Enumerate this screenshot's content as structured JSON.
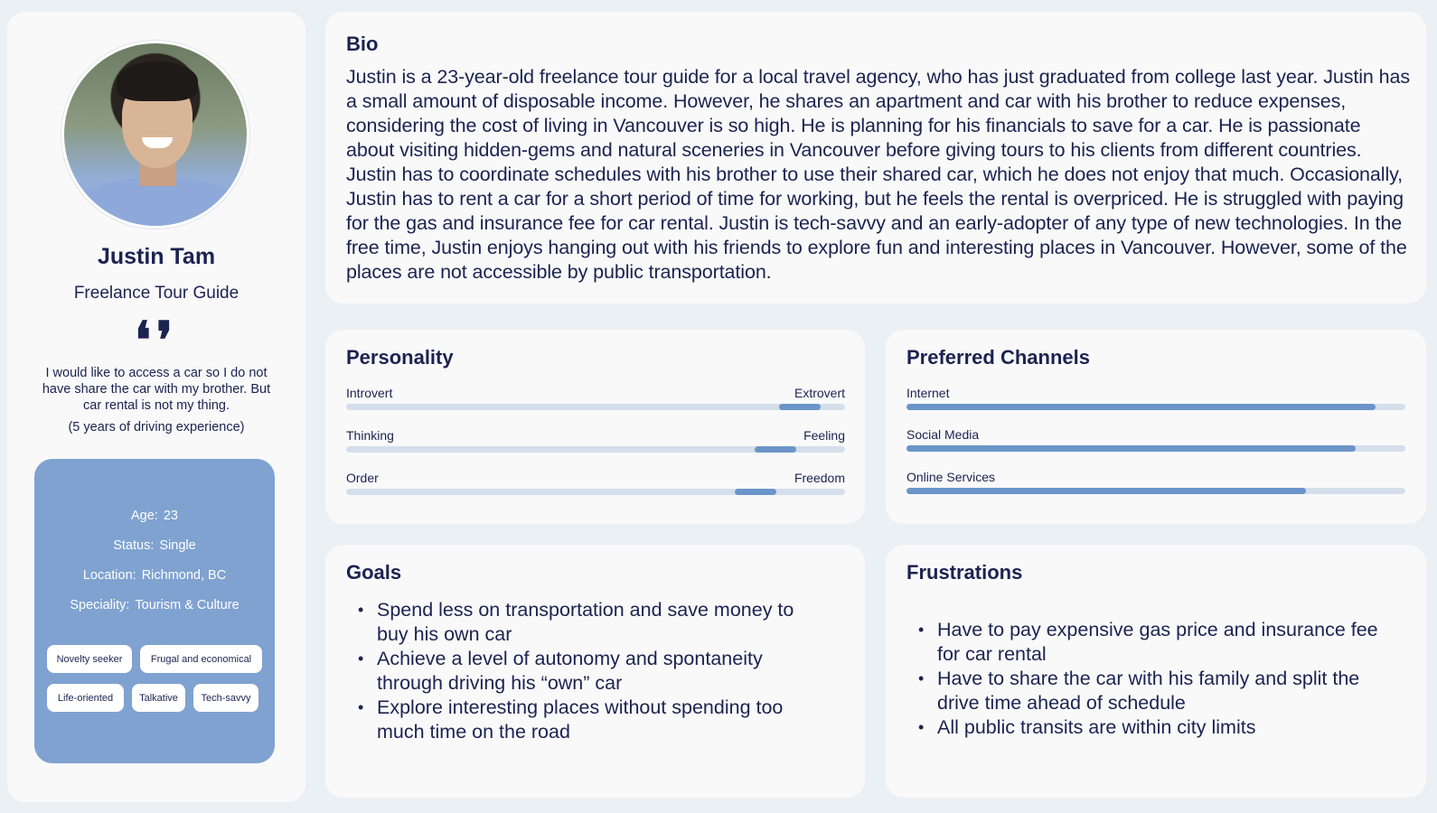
{
  "profile": {
    "name": "Justin Tam",
    "role": "Freelance Tour Guide",
    "quote_icon": "quote-icon",
    "quote": "I would like to access a car so I do not have share the car with my brother. But car rental is not my thing.",
    "driving": "(5 years of driving experience)",
    "info": [
      {
        "label": "Age:",
        "value": "23"
      },
      {
        "label": "Status:",
        "value": "Single"
      },
      {
        "label": "Location:",
        "value": "Richmond, BC"
      },
      {
        "label": "Speciality:",
        "value": "Tourism & Culture"
      }
    ],
    "tags": [
      "Novelty seeker",
      "Frugal and economical",
      "Life-oriented",
      "Talkative",
      "Tech-savvy"
    ],
    "accent_color": "#7fa2d0"
  },
  "bio": {
    "title": "Bio",
    "text": "Justin is a 23-year-old freelance tour guide for a local travel agency, who has just graduated from college last year. Justin has a small amount of disposable income. However, he shares an apartment and car with his brother to reduce expenses, considering the cost of living in Vancouver is so high. He is planning for his financials to save for a car. He is passionate about visiting hidden-gems and natural sceneries in Vancouver before giving tours to his clients from different countries. Justin has to coordinate schedules with his brother to use their shared car, which he does not enjoy that much. Occasionally, Justin has to rent a car for a short period of time for working, but he feels the rental is overpriced. He is struggled with paying for the gas and insurance fee for car rental. Justin is tech-savvy and an early-adopter of any type of new technologies. In the free time, Justin enjoys hanging out with his friends to explore fun and interesting places in Vancouver. However, some of the places are not accessible by public transportation."
  },
  "personality": {
    "title": "Personality",
    "traits": [
      {
        "left": "Introvert",
        "right": "Extrovert",
        "position": 0.91
      },
      {
        "left": "Thinking",
        "right": "Feeling",
        "position": 0.86
      },
      {
        "left": "Order",
        "right": "Freedom",
        "position": 0.82
      }
    ]
  },
  "channels": {
    "title": "Preferred Channels",
    "items": [
      {
        "label": "Internet",
        "level": 0.94
      },
      {
        "label": "Social Media",
        "level": 0.9
      },
      {
        "label": "Online Services",
        "level": 0.8
      }
    ]
  },
  "goals": {
    "title": "Goals",
    "items": [
      "Spend less on transportation and save money to buy his own car",
      "Achieve a level of autonomy and spontaneity through driving his “own” car",
      "Explore interesting places without spending too much time on the road"
    ]
  },
  "frustrations": {
    "title": "Frustrations",
    "items": [
      "Have to pay expensive gas price and insurance fee for car rental",
      "Have to share the car with his family and split the drive time ahead of schedule",
      "All public transits are within city limits"
    ]
  }
}
